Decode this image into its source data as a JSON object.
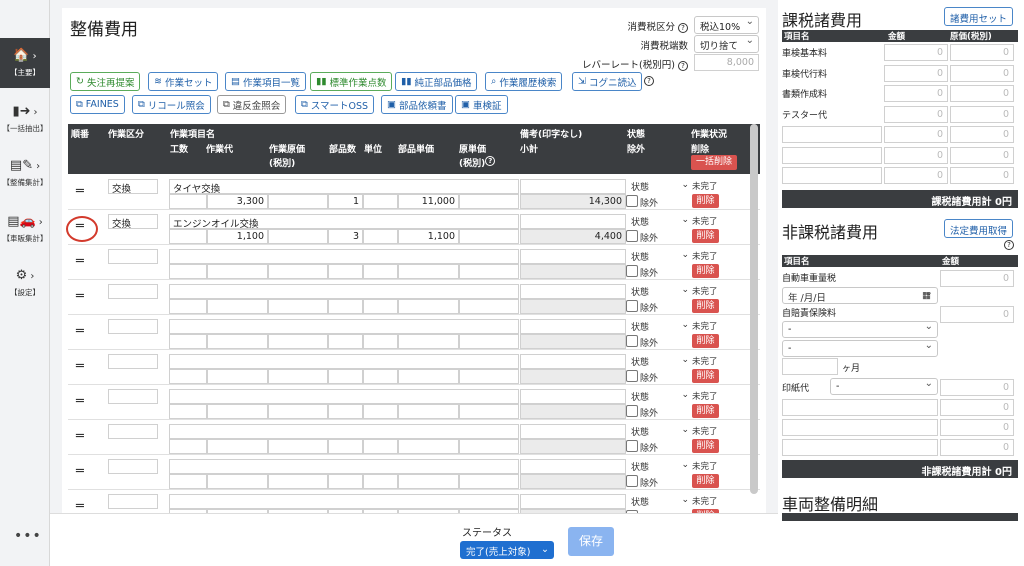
{
  "nav": [
    {
      "label": "【主要】",
      "icon": "home-icon"
    },
    {
      "label": "【一括抽出】",
      "icon": "file-export-icon"
    },
    {
      "label": "【整備集計】",
      "icon": "wrench-doc-icon"
    },
    {
      "label": "【車販集計】",
      "icon": "car-icon"
    },
    {
      "label": "【設定】",
      "icon": "gear-icon"
    }
  ],
  "main": {
    "title": "整備費用",
    "tax_type_label": "消費税区分",
    "tax_type_value": "税込10%",
    "tax_round_label": "消費税端数",
    "tax_round_value": "切り捨て",
    "labor_rate_label": "レバーレート(税別円)",
    "labor_rate_placeholder": "8,000",
    "buttons_row1": [
      "失注再提案",
      "作業セット",
      "作業項目一覧",
      "標準作業点数",
      "純正部品価格",
      "作業履歴検索",
      "コグニ読込"
    ],
    "buttons_row2": [
      "FAINES",
      "リコール照会",
      "違反金照会",
      "スマートOSS",
      "部品依頼書",
      "車検証"
    ],
    "header": {
      "order": "順番",
      "work_type": "作業区分",
      "work_item": "作業項目名",
      "labor_hours": "工数",
      "labor_cost": "作業代",
      "work_cost_price": "作業原価",
      "tax_excl": "(税別)",
      "part_qty": "部品数",
      "unit": "単位",
      "part_price": "部品単価",
      "orig_price": "原単価",
      "notes": "備考(印字なし)",
      "subtotal": "小計",
      "status": "状態",
      "exclude": "除外",
      "work_status": "作業状況",
      "delete": "削除",
      "bulk_delete": "一括削除"
    },
    "rows": [
      {
        "type": "交換",
        "name": "タイヤ交換",
        "labor": "3,300",
        "qty": "1",
        "price": "11,000",
        "subtotal": "14,300"
      },
      {
        "type": "交換",
        "name": "エンジンオイル交換",
        "labor": "1,100",
        "qty": "3",
        "price": "1,100",
        "subtotal": "4,400"
      },
      {
        "type": "",
        "name": "",
        "labor": "",
        "qty": "",
        "price": "",
        "subtotal": ""
      },
      {
        "type": "",
        "name": "",
        "labor": "",
        "qty": "",
        "price": "",
        "subtotal": ""
      },
      {
        "type": "",
        "name": "",
        "labor": "",
        "qty": "",
        "price": "",
        "subtotal": ""
      },
      {
        "type": "",
        "name": "",
        "labor": "",
        "qty": "",
        "price": "",
        "subtotal": ""
      },
      {
        "type": "",
        "name": "",
        "labor": "",
        "qty": "",
        "price": "",
        "subtotal": ""
      },
      {
        "type": "",
        "name": "",
        "labor": "",
        "qty": "",
        "price": "",
        "subtotal": ""
      },
      {
        "type": "",
        "name": "",
        "labor": "",
        "qty": "",
        "price": "",
        "subtotal": ""
      },
      {
        "type": "",
        "name": "",
        "labor": "",
        "qty": "",
        "price": "",
        "subtotal": ""
      }
    ],
    "row_status": "状態",
    "row_exclude": "除外",
    "row_incomplete": "未完了",
    "row_delete": "削除"
  },
  "taxable": {
    "title": "課税諸費用",
    "set_button": "諸費用セット",
    "col_name": "項目名",
    "col_amount": "金額",
    "col_cost": "原価(税別)",
    "items": [
      "車検基本料",
      "車検代行料",
      "書類作成料",
      "テスター代",
      "",
      "",
      ""
    ],
    "zero": "0",
    "total": "課税諸費用計 0円"
  },
  "nontaxable": {
    "title": "非課税諸費用",
    "button": "法定費用取得",
    "col_name": "項目名",
    "col_amount": "金額",
    "weight_tax": "自動車重量税",
    "date_placeholder": "年 /月/日",
    "insurance": "自賠責保険料",
    "dash": "-",
    "months": "ヶ月",
    "stamp": "印紙代",
    "zero": "0",
    "total": "非課税諸費用計 0円"
  },
  "detail_title": "車両整備明細",
  "footer": {
    "status_label": "ステータス",
    "status_value": "完了(売上対象)",
    "save": "保存"
  }
}
